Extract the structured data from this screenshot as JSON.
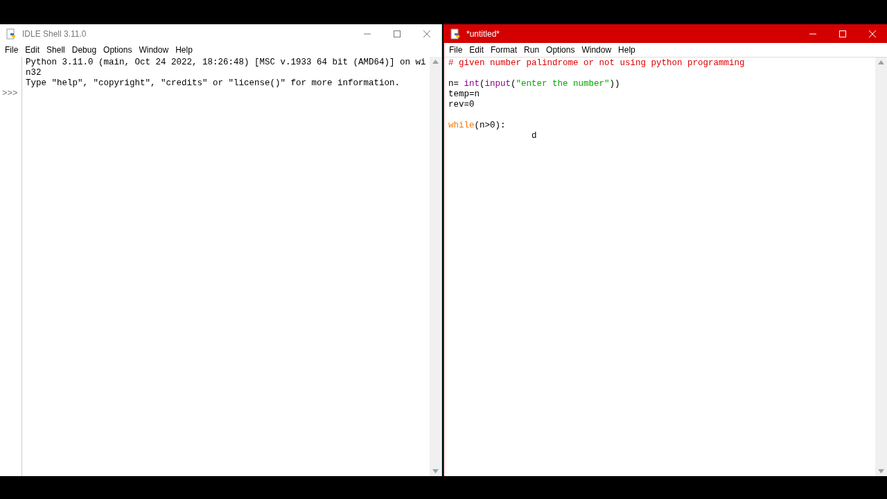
{
  "shell_window": {
    "title": "IDLE Shell 3.11.0",
    "active": false,
    "menu": [
      "File",
      "Edit",
      "Shell",
      "Debug",
      "Options",
      "Window",
      "Help"
    ],
    "output_lines": [
      "Python 3.11.0 (main, Oct 24 2022, 18:26:48) [MSC v.1933 64 bit (AMD64)] on wi",
      "n32",
      "Type \"help\", \"copyright\", \"credits\" or \"license()\" for more information."
    ],
    "prompt": ">>>"
  },
  "editor_window": {
    "title": "*untitled*",
    "active": true,
    "menu": [
      "File",
      "Edit",
      "Format",
      "Run",
      "Options",
      "Window",
      "Help"
    ],
    "code_lines": [
      {
        "kind": "code",
        "tokens": [
          {
            "kind": "comment",
            "text": "# given number palindrome or not using python programming"
          }
        ]
      },
      {
        "kind": "blank"
      },
      {
        "kind": "code",
        "tokens": [
          {
            "kind": "plain",
            "text": "n= "
          },
          {
            "kind": "builtin",
            "text": "int"
          },
          {
            "kind": "plain",
            "text": "("
          },
          {
            "kind": "builtin",
            "text": "input"
          },
          {
            "kind": "plain",
            "text": "("
          },
          {
            "kind": "string",
            "text": "\"enter the number\""
          },
          {
            "kind": "plain",
            "text": "))"
          }
        ]
      },
      {
        "kind": "code",
        "tokens": [
          {
            "kind": "plain",
            "text": "temp=n"
          }
        ]
      },
      {
        "kind": "code",
        "tokens": [
          {
            "kind": "plain",
            "text": "rev=0"
          }
        ]
      },
      {
        "kind": "blank"
      },
      {
        "kind": "code",
        "tokens": [
          {
            "kind": "keyword",
            "text": "while"
          },
          {
            "kind": "plain",
            "text": "(n>0):"
          }
        ]
      },
      {
        "kind": "code",
        "tokens": [
          {
            "kind": "plain",
            "text": "                d"
          }
        ]
      }
    ]
  }
}
